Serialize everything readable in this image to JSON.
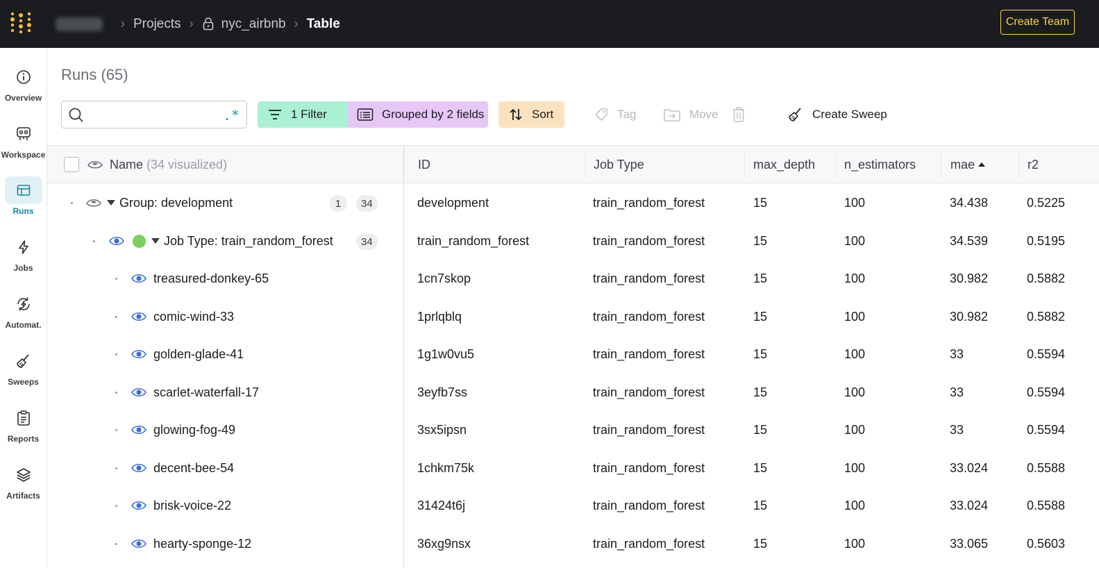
{
  "topbar": {
    "breadcrumb": {
      "project": "Projects",
      "name": "nyc_airbnb",
      "current": "Table"
    },
    "create_team": "Create Team"
  },
  "nav": [
    {
      "label": "Overview",
      "icon": "info-icon"
    },
    {
      "label": "Workspace",
      "icon": "workspace-icon"
    },
    {
      "label": "Runs",
      "icon": "table-icon",
      "active": true
    },
    {
      "label": "Jobs",
      "icon": "lightning-icon"
    },
    {
      "label": "Automat.",
      "icon": "automation-icon"
    },
    {
      "label": "Sweeps",
      "icon": "broom-icon"
    },
    {
      "label": "Reports",
      "icon": "clipboard-icon"
    },
    {
      "label": "Artifacts",
      "icon": "layers-icon"
    }
  ],
  "main": {
    "title": "Runs (65)",
    "search": {
      "placeholder": "",
      "value": "",
      "regex_symbol": ".*"
    },
    "toolbar": {
      "filter": "1 Filter",
      "group": "Grouped by 2 fields",
      "sort": "Sort",
      "tag": "Tag",
      "move": "Move",
      "create_sweep": "Create Sweep"
    },
    "table": {
      "columns": {
        "name": "Name",
        "name_suffix": "(34 visualized)",
        "id": "ID",
        "job_type": "Job Type",
        "max_depth": "max_depth",
        "n_estimators": "n_estimators",
        "mae": "mae",
        "r2": "r2"
      },
      "group1": {
        "name": "Group: development",
        "badge_a": "1",
        "badge_b": "34",
        "id": "development",
        "job_type": "train_random_forest",
        "max_depth": "15",
        "n_estimators": "100",
        "mae": "34.438",
        "r2": "0.5225"
      },
      "group2": {
        "name": "Job Type: train_random_forest",
        "badge": "34",
        "id": "train_random_forest",
        "job_type": "train_random_forest",
        "max_depth": "15",
        "n_estimators": "100",
        "mae": "34.539",
        "r2": "0.5195"
      },
      "rows": [
        {
          "name": "treasured-donkey-65",
          "id": "1cn7skop",
          "job_type": "train_random_forest",
          "max_depth": "15",
          "n_estimators": "100",
          "mae": "30.982",
          "r2": "0.5882"
        },
        {
          "name": "comic-wind-33",
          "id": "1prlqblq",
          "job_type": "train_random_forest",
          "max_depth": "15",
          "n_estimators": "100",
          "mae": "30.982",
          "r2": "0.5882"
        },
        {
          "name": "golden-glade-41",
          "id": "1g1w0vu5",
          "job_type": "train_random_forest",
          "max_depth": "15",
          "n_estimators": "100",
          "mae": "33",
          "r2": "0.5594"
        },
        {
          "name": "scarlet-waterfall-17",
          "id": "3eyfb7ss",
          "job_type": "train_random_forest",
          "max_depth": "15",
          "n_estimators": "100",
          "mae": "33",
          "r2": "0.5594"
        },
        {
          "name": "glowing-fog-49",
          "id": "3sx5ipsn",
          "job_type": "train_random_forest",
          "max_depth": "15",
          "n_estimators": "100",
          "mae": "33",
          "r2": "0.5594"
        },
        {
          "name": "decent-bee-54",
          "id": "1chkm75k",
          "job_type": "train_random_forest",
          "max_depth": "15",
          "n_estimators": "100",
          "mae": "33.024",
          "r2": "0.5588"
        },
        {
          "name": "brisk-voice-22",
          "id": "31424t6j",
          "job_type": "train_random_forest",
          "max_depth": "15",
          "n_estimators": "100",
          "mae": "33.024",
          "r2": "0.5588"
        },
        {
          "name": "hearty-sponge-12",
          "id": "36xg9nsx",
          "job_type": "train_random_forest",
          "max_depth": "15",
          "n_estimators": "100",
          "mae": "33.065",
          "r2": "0.5603"
        }
      ]
    }
  },
  "colors": {
    "topbar": "#1a1c1f",
    "accent_yellow": "#fcd34d",
    "filter_bg": "#a9f0d5",
    "group_bg": "#e6c7f7",
    "sort_bg": "#fde2bf",
    "eye_blue": "#3b6fd6",
    "status_green": "#7ad05a",
    "active_teal": "#0f8aa0"
  }
}
